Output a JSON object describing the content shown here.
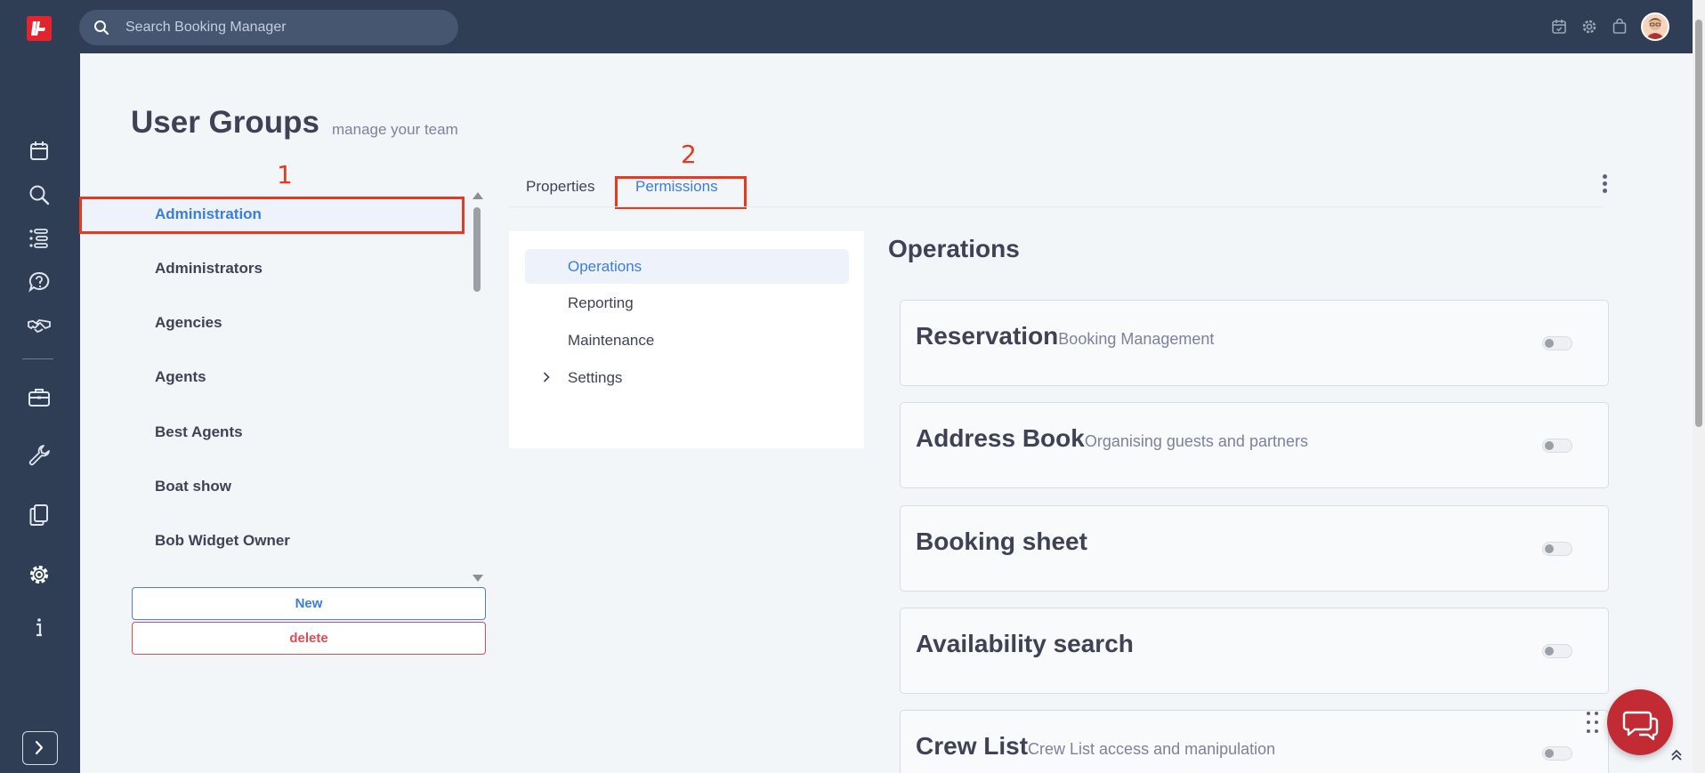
{
  "search": {
    "placeholder": "Search Booking Manager"
  },
  "page": {
    "title": "User Groups",
    "subtitle": "manage your team"
  },
  "groups": [
    {
      "label": "Administration",
      "active": true
    },
    {
      "label": "Administrators"
    },
    {
      "label": "Agencies"
    },
    {
      "label": "Agents"
    },
    {
      "label": "Best Agents"
    },
    {
      "label": "Boat show"
    },
    {
      "label": "Bob Widget Owner"
    }
  ],
  "buttons": {
    "new": "New",
    "delete": "delete"
  },
  "annotations": {
    "one": "1",
    "two": "2"
  },
  "tabs": {
    "properties": "Properties",
    "permissions": "Permissions",
    "active": "permissions"
  },
  "perm_nav": [
    {
      "label": "Operations",
      "active": true
    },
    {
      "label": "Reporting"
    },
    {
      "label": "Maintenance"
    },
    {
      "label": "Settings",
      "expandable": true
    }
  ],
  "section": {
    "title": "Operations"
  },
  "permissions": [
    {
      "name": "Reservation",
      "desc": "Booking Management",
      "enabled": false
    },
    {
      "name": "Address Book",
      "desc": "Organising guests and partners",
      "enabled": false
    },
    {
      "name": "Booking sheet",
      "desc": "",
      "enabled": false
    },
    {
      "name": "Availability search",
      "desc": "",
      "enabled": false
    },
    {
      "name": "Crew List",
      "desc": "Crew List access and manipulation",
      "enabled": false
    }
  ],
  "colors": {
    "nav_bg": "#2f3e55",
    "accent": "#3b7ddd",
    "danger": "#e04b54",
    "annotation": "#e8391f",
    "brand": "#e3232e"
  },
  "icons": {
    "rail": [
      "calendar-icon",
      "search-icon",
      "list-icon",
      "help-chat-icon",
      "handshake-icon",
      "briefcase-icon",
      "wrench-icon",
      "documents-icon",
      "gear-icon",
      "info-icon"
    ],
    "top": [
      "calendar-check-icon",
      "gear-icon",
      "shopping-bag-icon"
    ]
  }
}
